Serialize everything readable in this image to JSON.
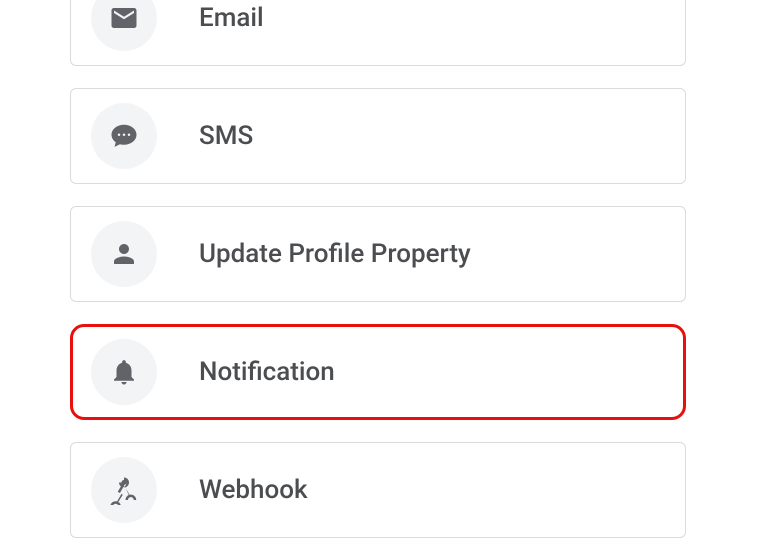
{
  "options": [
    {
      "id": "email",
      "label": "Email",
      "icon": "email-icon",
      "highlight": false
    },
    {
      "id": "sms",
      "label": "SMS",
      "icon": "sms-icon",
      "highlight": false
    },
    {
      "id": "update-profile",
      "label": "Update Profile Property",
      "icon": "user-icon",
      "highlight": false
    },
    {
      "id": "notification",
      "label": "Notification",
      "icon": "bell-icon",
      "highlight": true
    },
    {
      "id": "webhook",
      "label": "Webhook",
      "icon": "webhook-icon",
      "highlight": false
    }
  ]
}
